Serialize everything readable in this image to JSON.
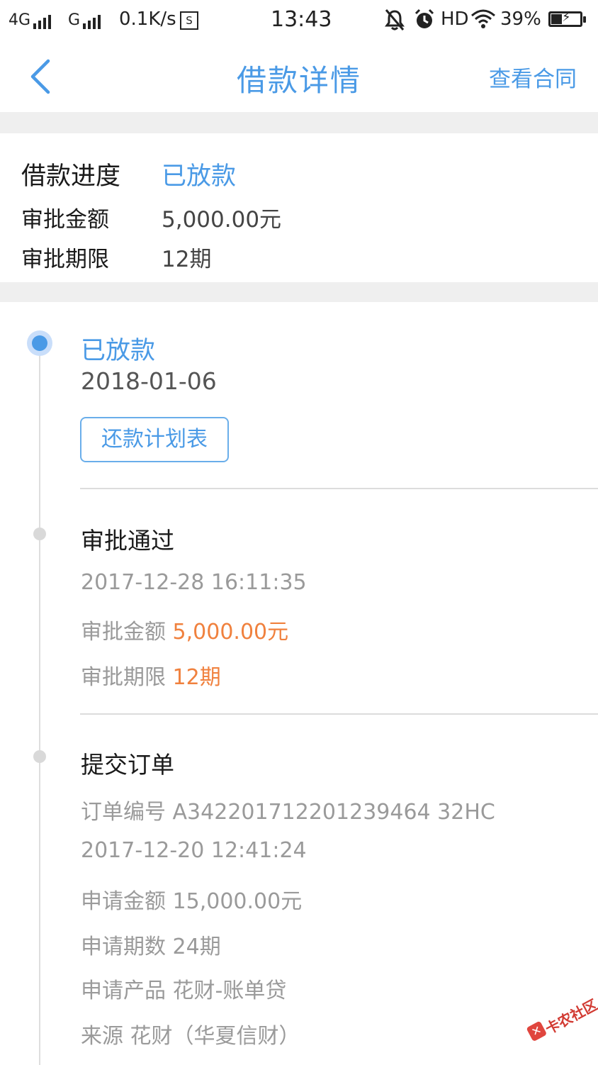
{
  "status_bar": {
    "network1": "4G",
    "network2": "G",
    "speed": "0.1K/s",
    "s_icon": "S",
    "time": "13:43",
    "hd": "HD",
    "battery": "39%",
    "icons": [
      "signal-icon",
      "mute-bell-icon",
      "alarm-icon",
      "wifi-icon",
      "battery-icon"
    ]
  },
  "nav": {
    "title": "借款详情",
    "action": "查看合同"
  },
  "summary": {
    "progress_label": "借款进度",
    "progress_value": "已放款",
    "amount_label": "审批金额",
    "amount_value": "5,000.00元",
    "term_label": "审批期限",
    "term_value": "12期"
  },
  "timeline": {
    "step1": {
      "title": "已放款",
      "date": "2018-01-06",
      "button": "还款计划表"
    },
    "step2": {
      "title": "审批通过",
      "time": "2017-12-28 16:11:35",
      "amount_label": "审批金额",
      "amount_value": "5,000.00元",
      "term_label": "审批期限",
      "term_value": "12期"
    },
    "step3": {
      "title": "提交订单",
      "order_no": "订单编号 A342201712201239464 32HC",
      "time": "2017-12-20 12:41:24",
      "apply_amount": "申请金额 15,000.00元",
      "apply_term": "申请期数 24期",
      "product": "申请产品 花财-账单贷",
      "source": "来源 花财（华夏信财）"
    }
  },
  "watermark": {
    "text": "卡农社区"
  },
  "colors": {
    "accent": "#4a9ae6",
    "highlight": "#f0813e",
    "muted": "#9a9a9a"
  }
}
